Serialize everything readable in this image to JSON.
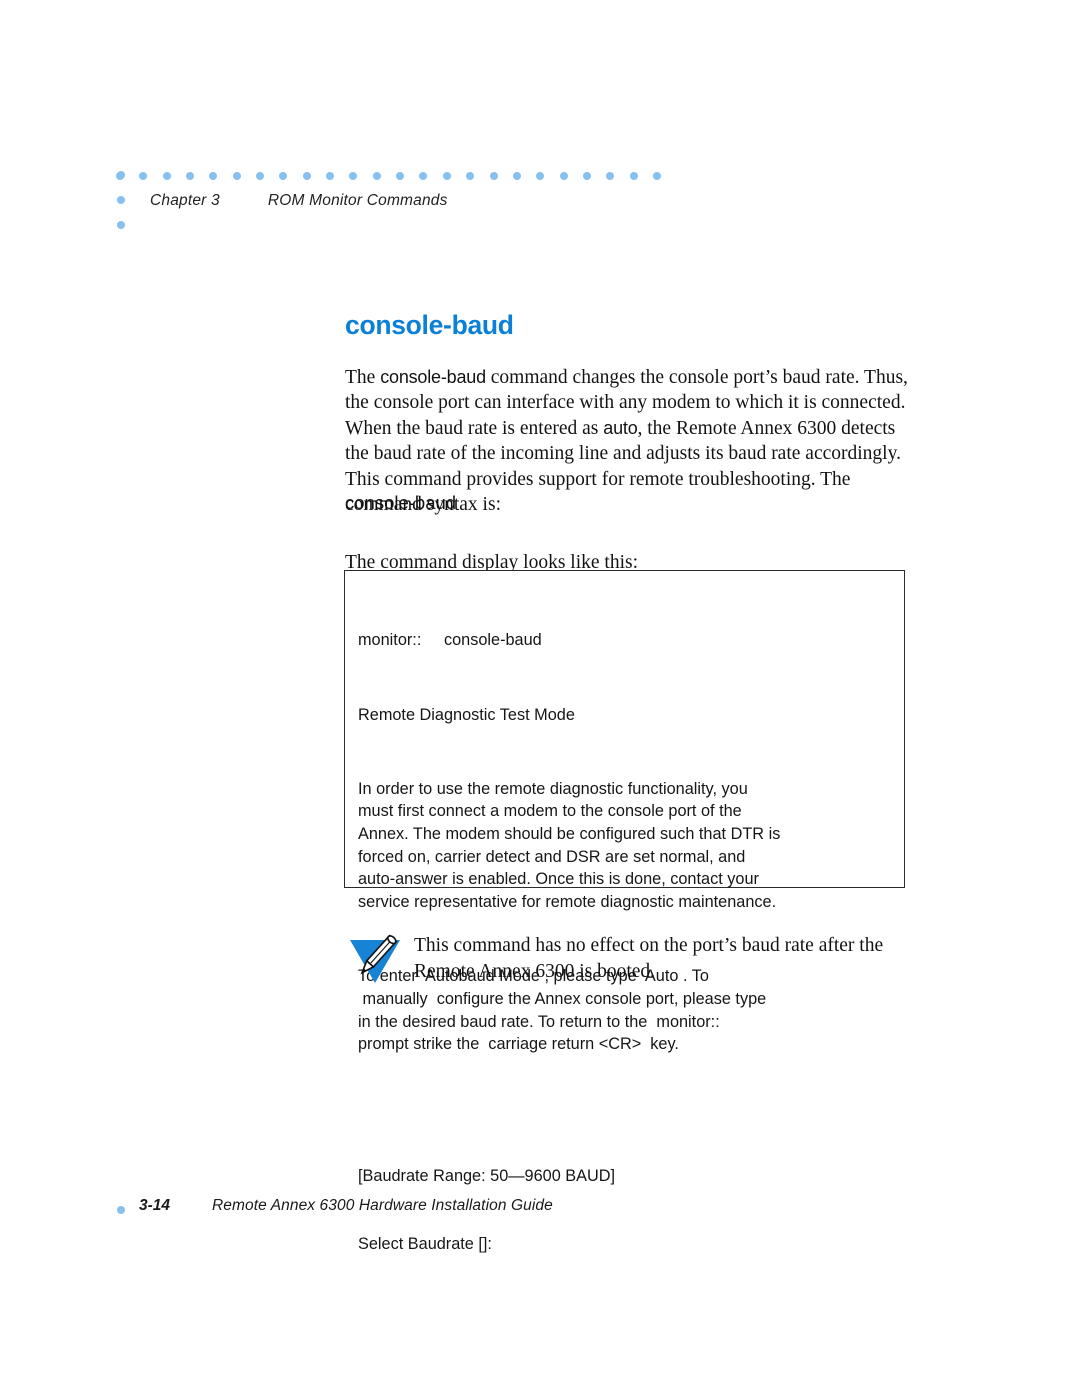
{
  "header": {
    "chapter": "Chapter 3",
    "section": "ROM Monitor Commands",
    "dot_color": "#87c0ee",
    "dot_row_count": 24,
    "dot_col_count": 3
  },
  "title": {
    "text": "console-baud",
    "color": "#0b80d8"
  },
  "body": {
    "intro_1": "The ",
    "intro_term_1": "console-baud",
    "intro_2": " command changes the console port’s baud rate. Thus, the console port can interface with any modem to which it is connected. When the baud rate is entered as ",
    "intro_term_2": "auto",
    "intro_3": ", the Remote Annex 6300 detects the baud rate of the incoming line and adjusts its baud rate accordingly. This command provides support for remote troubleshooting. The command syntax is:",
    "syntax": "console-baud",
    "display_lead": "The command display looks like this:"
  },
  "code_box": {
    "border_color": "#2b2b2b",
    "lines": [
      "monitor::     console-baud",
      "Remote Diagnostic Test Mode",
      "In order to use the remote diagnostic functionality, you\nmust first connect a modem to the console port of the\nAnnex. The modem should be configured such that DTR is\nforced on, carrier detect and DSR are set normal, and\nauto-answer is enabled. Once this is done, contact your\nservice representative for remote diagnostic maintenance.",
      "To enter  Autobaud Mode , please type  Auto . To\n manually  configure the Annex console port, please type\nin the desired baud rate. To return to the  monitor::\nprompt strike the  carriage return <CR>  key.",
      "[Baudrate Range: 50—9600 BAUD]",
      "Select Baudrate []:"
    ],
    "line_0": "monitor::     console-baud",
    "line_1": "Remote Diagnostic Test Mode",
    "line_2": "In order to use the remote diagnostic functionality, you\nmust first connect a modem to the console port of the\nAnnex. The modem should be configured such that DTR is\nforced on, carrier detect and DSR are set normal, and\nauto-answer is enabled. Once this is done, contact your\nservice representative for remote diagnostic maintenance.",
    "line_3": "To enter  Autobaud Mode , please type  Auto . To\n manually  configure the Annex console port, please type\nin the desired baud rate. To return to the  monitor::\nprompt strike the  carriage return <CR>  key.",
    "line_4": "[Baudrate Range: 50—9600 BAUD]",
    "line_5": "Select Baudrate []:"
  },
  "note": {
    "icon": "pencil-triangle-note-icon",
    "icon_color": "#1683d4",
    "text": "This command has no effect on the port’s baud rate after the Remote Annex 6300 is booted."
  },
  "footer": {
    "page_number": "3-14",
    "document_title": "Remote Annex 6300 Hardware Installation Guide",
    "dot_color": "#87c0ee"
  }
}
